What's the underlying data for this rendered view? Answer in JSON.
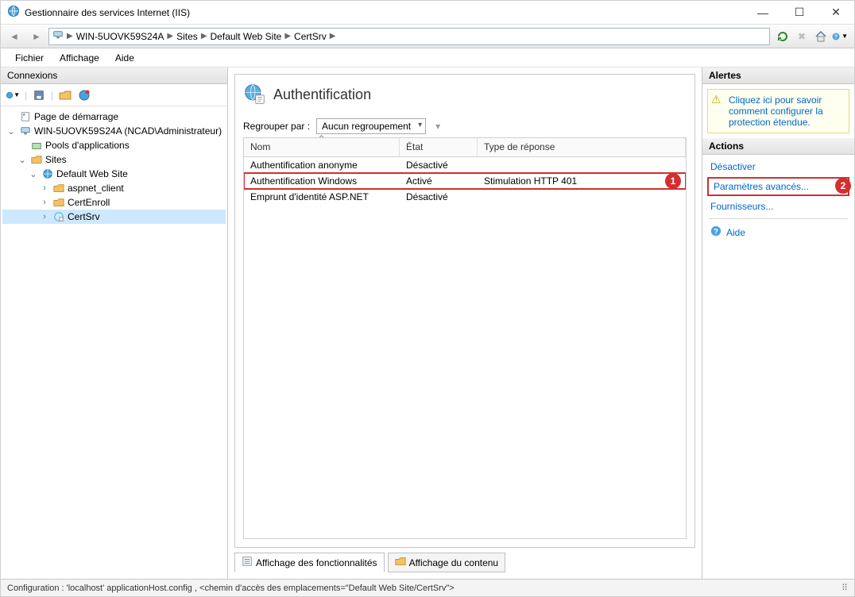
{
  "window": {
    "title": "Gestionnaire des services Internet (IIS)"
  },
  "breadcrumb": {
    "items": [
      "WIN-5UOVK59S24A",
      "Sites",
      "Default Web Site",
      "CertSrv"
    ]
  },
  "menu": {
    "file": "Fichier",
    "view": "Affichage",
    "help": "Aide"
  },
  "sidebar": {
    "title": "Connexions",
    "tree": {
      "start_page": "Page de démarrage",
      "server": "WIN-5UOVK59S24A (NCAD\\Administrateur)",
      "app_pools": "Pools d'applications",
      "sites": "Sites",
      "default_site": "Default Web Site",
      "aspnet_client": "aspnet_client",
      "certenroll": "CertEnroll",
      "certsrv": "CertSrv"
    }
  },
  "page": {
    "title": "Authentification",
    "group_by_label": "Regrouper par :",
    "group_by_value": "Aucun regroupement",
    "columns": {
      "name": "Nom",
      "state": "État",
      "response": "Type de réponse"
    },
    "rows": [
      {
        "name": "Authentification anonyme",
        "state": "Désactivé",
        "response": ""
      },
      {
        "name": "Authentification Windows",
        "state": "Activé",
        "response": "Stimulation HTTP 401"
      },
      {
        "name": "Emprunt d'identité ASP.NET",
        "state": "Désactivé",
        "response": ""
      }
    ],
    "tabs": {
      "features": "Affichage des fonctionnalités",
      "content": "Affichage du contenu"
    }
  },
  "alerts": {
    "title": "Alertes",
    "text": "Cliquez ici pour savoir comment configurer la protection étendue."
  },
  "actions": {
    "title": "Actions",
    "disable": "Désactiver",
    "advanced": "Paramètres avancés...",
    "providers": "Fournisseurs...",
    "help": "Aide"
  },
  "status": {
    "text": "Configuration : 'localhost' applicationHost.config , <chemin d'accès des emplacements=\"Default Web Site/CertSrv\">"
  },
  "annot": {
    "one": "1",
    "two": "2"
  }
}
